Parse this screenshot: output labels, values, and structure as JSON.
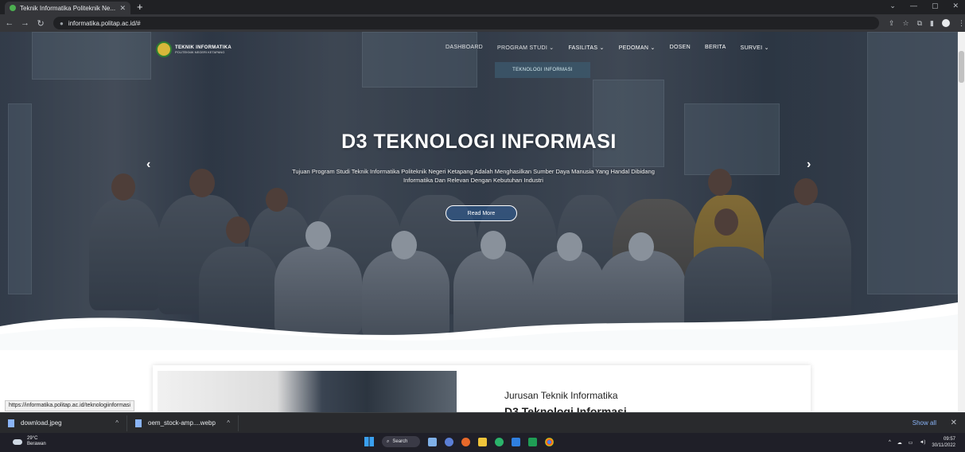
{
  "browser": {
    "tab_title": "Teknik Informatika Politeknik Ne...",
    "new_tab_glyph": "+",
    "url": "informatika.politap.ac.id/#",
    "window_controls": [
      "⌄",
      "—",
      "▢",
      "✕"
    ]
  },
  "site": {
    "logo_title": "TEKNIK INFORMATIKA",
    "logo_subtitle": "POLITEKNIK NEGERI KETAPANG",
    "nav": [
      {
        "label": "DASHBOARD"
      },
      {
        "label": "PROGRAM STUDI ⌄"
      },
      {
        "label": "FASILITAS ⌄"
      },
      {
        "label": "PEDOMAN ⌄"
      },
      {
        "label": "DOSEN"
      },
      {
        "label": "BERITA"
      },
      {
        "label": "SURVEI ⌄"
      }
    ],
    "dropdown_item": "TEKNOLOGI INFORMASI",
    "slide": {
      "title": "D3 TEKNOLOGI INFORMASI",
      "description": "Tujuan Program Studi Teknik Informatika Politeknik Negeri Ketapang Adalah Menghasilkan Sumber Daya Manusia Yang Handal Dibidang Informatika Dan Relevan Dengan Kebutuhan Industri",
      "button": "Read More",
      "prev_glyph": "‹",
      "next_glyph": "›"
    },
    "card": {
      "heading": "Jurusan Teknik Informatika",
      "subheading": "D3 Teknologi Informasi"
    },
    "status_url": "https://informatika.politap.ac.id/teknologiinformasi"
  },
  "downloads": {
    "items": [
      {
        "name": "download.jpeg"
      },
      {
        "name": "oem_stock-amp....webp"
      }
    ],
    "show_all": "Show all",
    "close_glyph": "✕"
  },
  "taskbar": {
    "weather_temp": "29°C",
    "weather_desc": "Berawan",
    "search_label": "Search",
    "time": "09:57",
    "date": "30/11/2022"
  },
  "colors": {
    "accent": "#3aa0f0",
    "hero_overlay": "#1e2837",
    "button_fill": "#285a96"
  }
}
